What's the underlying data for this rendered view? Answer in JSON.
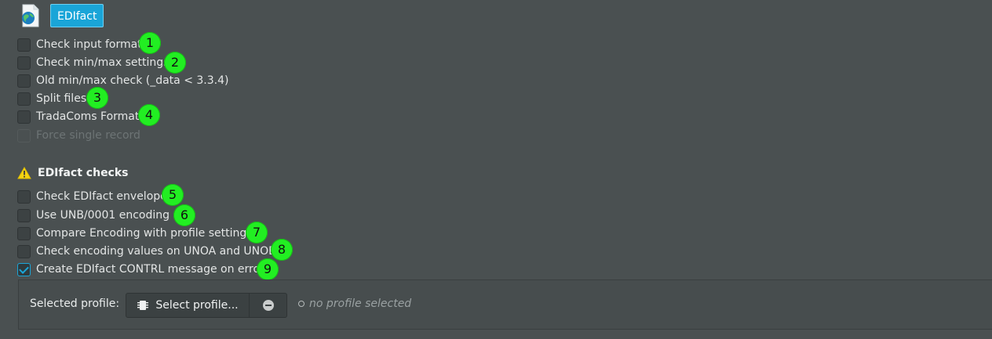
{
  "header": {
    "app_icon": "globe-document-icon",
    "tag_label": "EDIfact"
  },
  "options": [
    {
      "label": "Check input format",
      "checked": false,
      "disabled": false,
      "badge": "1"
    },
    {
      "label": "Check min/max settings",
      "checked": false,
      "disabled": false,
      "badge": "2"
    },
    {
      "label": "Old min/max check (_data < 3.3.4)",
      "checked": false,
      "disabled": false,
      "badge": ""
    },
    {
      "label": "Split files",
      "checked": false,
      "disabled": false,
      "badge": "3"
    },
    {
      "label": "TradaComs Format",
      "checked": false,
      "disabled": false,
      "badge": "4"
    },
    {
      "label": "Force single record",
      "checked": false,
      "disabled": true,
      "badge": ""
    }
  ],
  "edifact_section": {
    "title": "EDIfact checks",
    "icon": "warning-icon",
    "options": [
      {
        "label": "Check EDIfact envelope",
        "checked": false,
        "badge": "5"
      },
      {
        "label": "Use UNB/0001 encoding",
        "checked": false,
        "badge": "6"
      },
      {
        "label": "Compare Encoding with profile settings",
        "checked": false,
        "badge": "7"
      },
      {
        "label": "Check encoding values on UNOA and UNOB",
        "checked": false,
        "badge": "8"
      },
      {
        "label": "Create EDIfact CONTRL message on error",
        "checked": true,
        "badge": "9"
      }
    ]
  },
  "profile": {
    "label": "Selected profile:",
    "select_button": "Select profile...",
    "select_icon": "chip-icon",
    "clear_icon": "minus-circle-icon",
    "status_text": "no profile selected"
  },
  "colors": {
    "background": "#4a5051",
    "accent": "#1aa5d8",
    "badge": "#22ee22"
  }
}
